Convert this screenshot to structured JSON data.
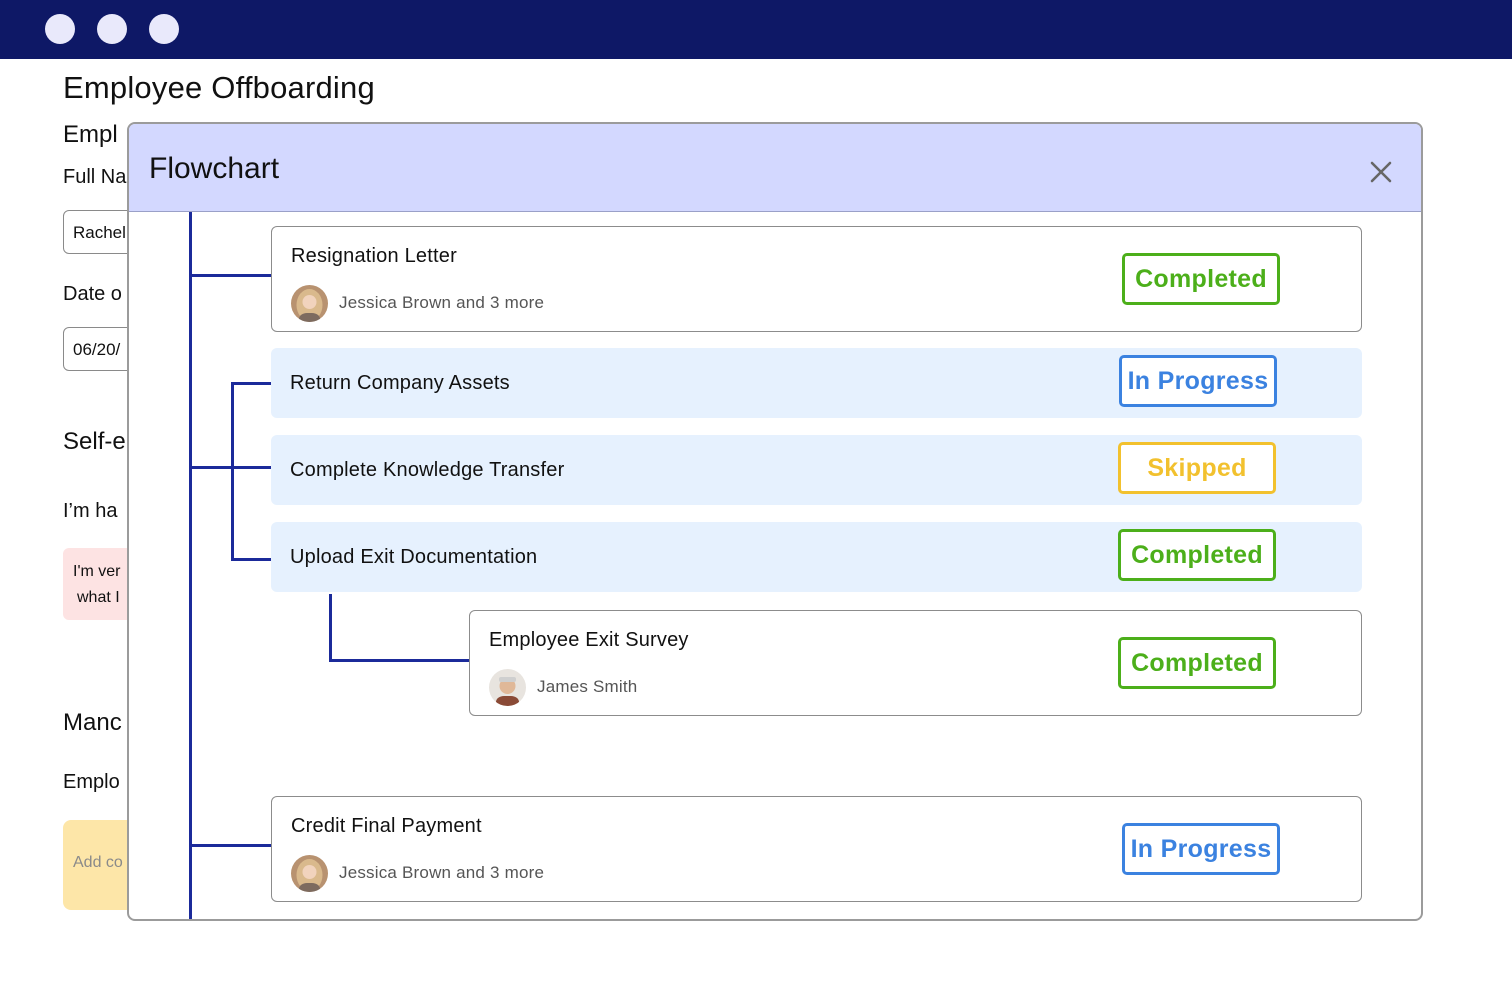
{
  "window": {
    "controls": [
      "window-dot",
      "window-dot",
      "window-dot"
    ]
  },
  "page": {
    "title": "Employee Offboarding",
    "section_heading_1": "Empl",
    "full_name_label": "Full Na",
    "full_name_value": "Rachel",
    "date_label": "Date o",
    "date_value": "06/20/",
    "section_heading_2": "Self-e",
    "question_label": "I’m ha",
    "answer_line_1": "I'm ver",
    "answer_line_2": "what I",
    "section_heading_3": "Manc",
    "employee_label": "Emplo",
    "comment_placeholder": "Add co"
  },
  "modal": {
    "title": "Flowchart",
    "close_icon": "close-icon",
    "steps": [
      {
        "title": "Resignation Letter",
        "assignee": "Jessica Brown and 3 more",
        "status": "Completed"
      },
      {
        "title": "Return Company Assets",
        "status": "In Progress"
      },
      {
        "title": "Complete Knowledge Transfer",
        "status": "Skipped"
      },
      {
        "title": "Upload Exit Documentation",
        "status": "Completed"
      },
      {
        "title": "Employee Exit Survey",
        "assignee": "James Smith",
        "status": "Completed"
      },
      {
        "title": "Credit Final Payment",
        "assignee": "Jessica Brown and 3 more",
        "status": "In Progress"
      }
    ]
  },
  "colors": {
    "titlebar": "#0e1866",
    "modal_header": "#d3d8ff",
    "connector": "#1b2a9a",
    "completed": "#4caf1a",
    "in_progress": "#3b82e0",
    "skipped": "#f2c12e",
    "filled_card": "#e6f1fe"
  }
}
